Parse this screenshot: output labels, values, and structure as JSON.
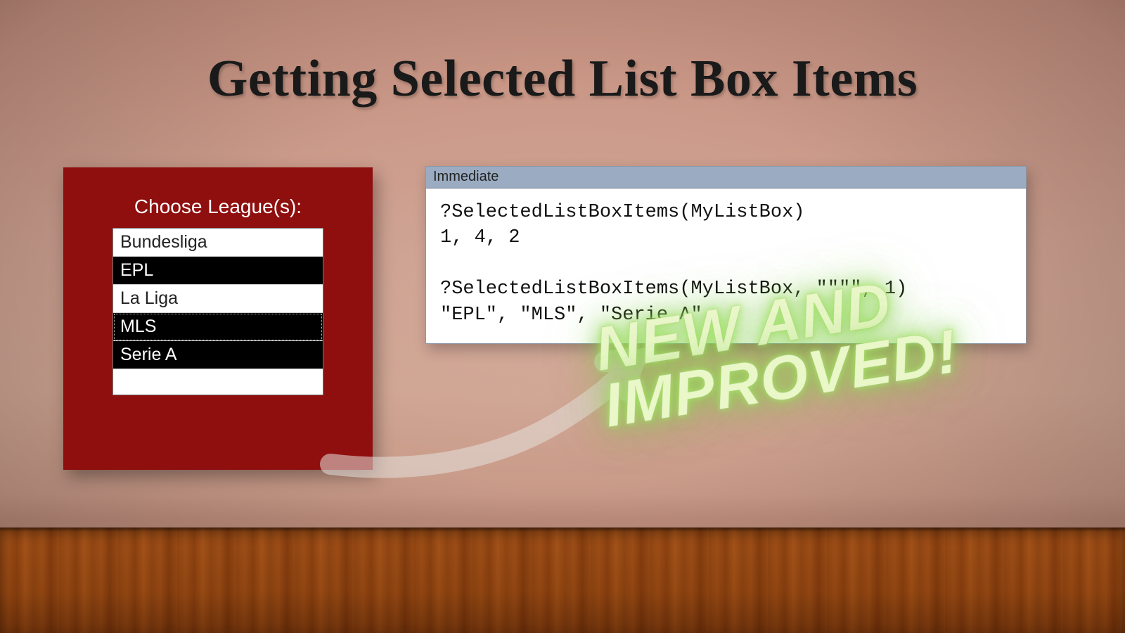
{
  "title": "Getting Selected List Box Items",
  "card": {
    "label": "Choose League(s):",
    "items": [
      {
        "text": "Bundesliga",
        "selected": false,
        "focus": false
      },
      {
        "text": "EPL",
        "selected": true,
        "focus": false
      },
      {
        "text": "La Liga",
        "selected": false,
        "focus": false
      },
      {
        "text": "MLS",
        "selected": true,
        "focus": true
      },
      {
        "text": "Serie A",
        "selected": true,
        "focus": false
      }
    ]
  },
  "immediate": {
    "title": "Immediate",
    "lines": [
      "?SelectedListBoxItems(MyListBox)",
      "1, 4, 2",
      "",
      "?SelectedListBoxItems(MyListBox, \"\"\"\", 1)",
      "\"EPL\", \"MLS\", \"Serie A\""
    ]
  },
  "badge": {
    "line1": "NEW AND",
    "line2": "IMPROVED!"
  }
}
